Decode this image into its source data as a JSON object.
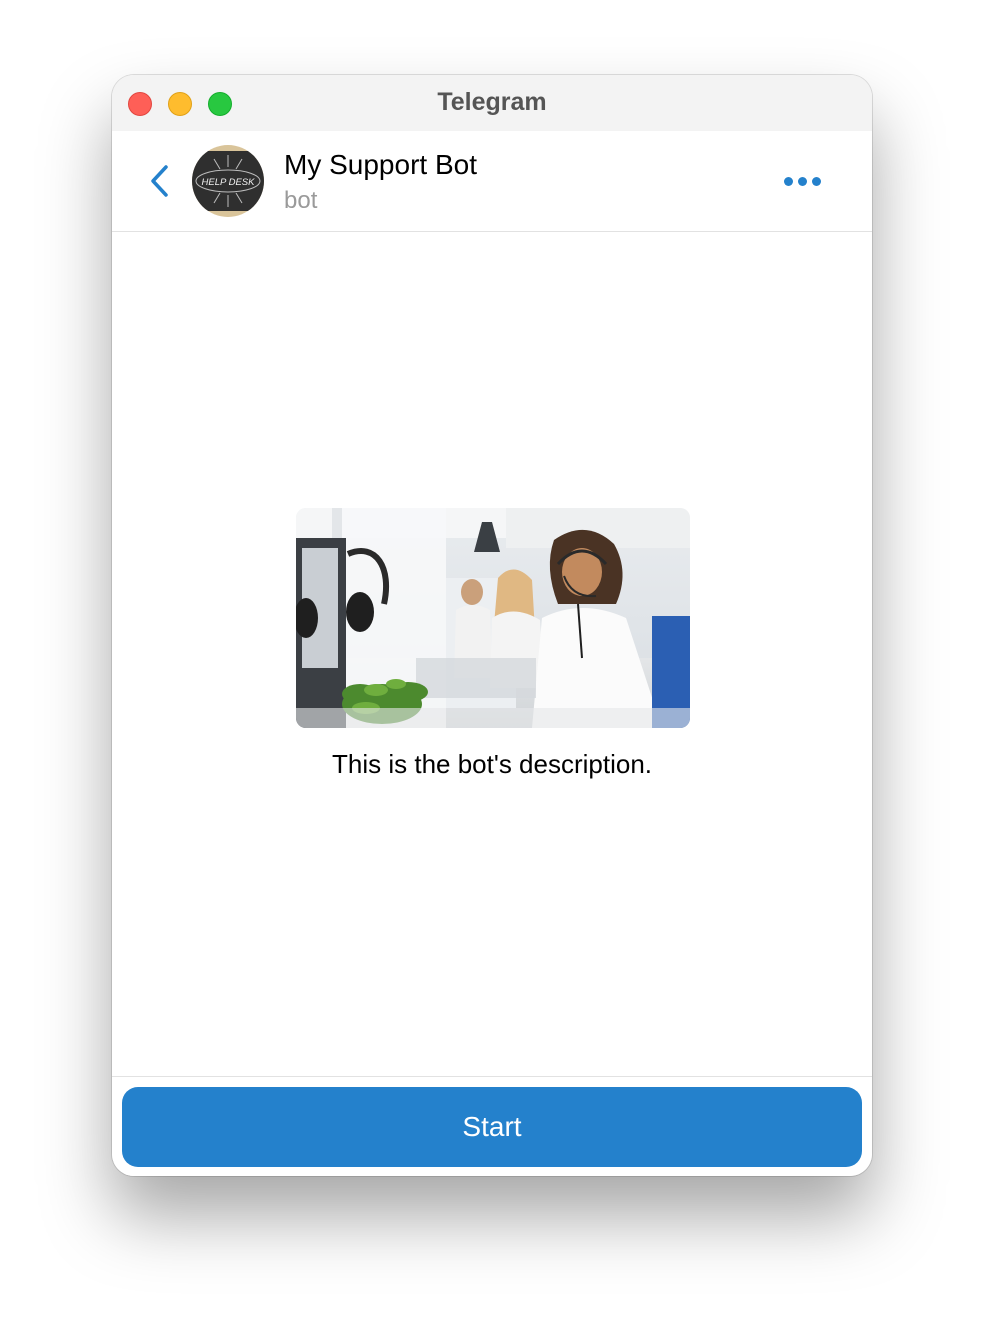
{
  "window": {
    "title": "Telegram"
  },
  "header": {
    "back_icon": "chevron-left-icon",
    "avatar_text": "HELP DESK",
    "name": "My Support Bot",
    "status": "bot",
    "more_icon": "ellipsis-icon"
  },
  "bot_info": {
    "image": "call-center-photo",
    "description": "This is the bot's description."
  },
  "footer": {
    "start_label": "Start"
  },
  "colors": {
    "accent": "#2481cc",
    "status_text": "#9a9a9a",
    "close": "#fe5f57",
    "minimize": "#febc2e",
    "maximize": "#28c840"
  }
}
